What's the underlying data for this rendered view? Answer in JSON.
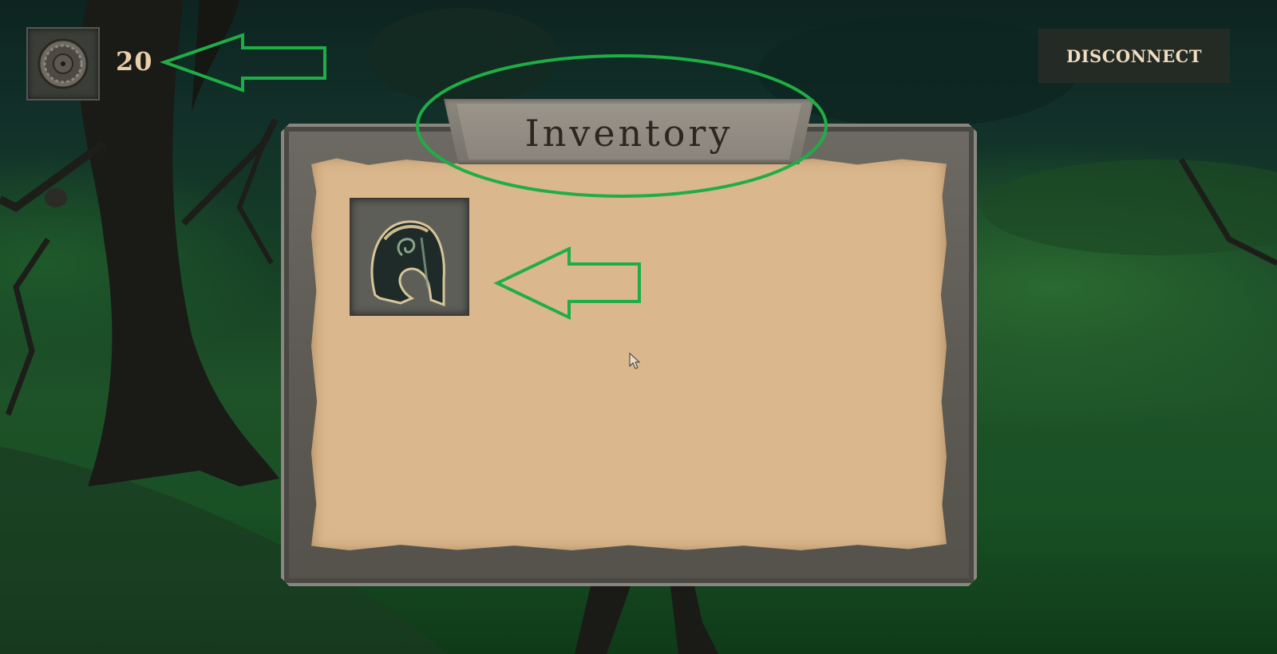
{
  "hud": {
    "coin_icon": "coin-icon",
    "coin_count": "20",
    "disconnect_label": "DISCONNECT"
  },
  "inventory": {
    "title": "Inventory",
    "items": [
      {
        "icon": "helmet-icon"
      }
    ]
  },
  "annotations": {
    "color": "#1fae45"
  },
  "colors": {
    "paper": "#dab78c",
    "frame": "#5e5b55",
    "hud_text": "#e8cfa9"
  }
}
